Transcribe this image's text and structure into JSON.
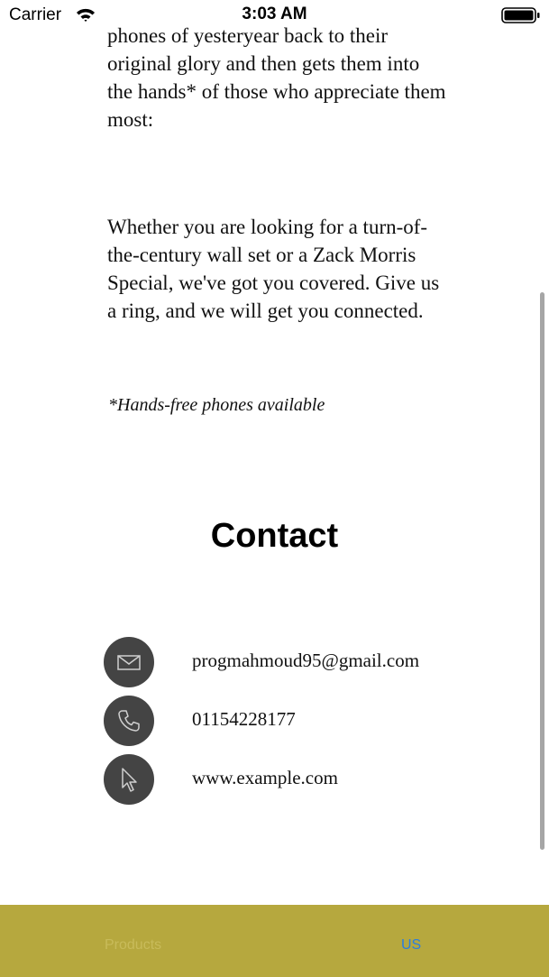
{
  "status_bar": {
    "carrier": "Carrier",
    "time": "3:03 AM"
  },
  "about": {
    "paragraph_1": "phones of  yesteryear back to their original glory and then gets them into the hands* of those who appreciate them most:",
    "paragraph_2": "Whether you are looking for a turn-of-the-century wall set or a Zack Morris Special, we've got you covered. Give us a ring, and we will get you connected.",
    "footnote": "*Hands-free phones available"
  },
  "contact": {
    "heading": "Contact",
    "email": "progmahmoud95@gmail.com",
    "phone": "01154228177",
    "website": "www.example.com"
  },
  "tabs": [
    {
      "label": "Products"
    },
    {
      "label": "US"
    }
  ],
  "colors": {
    "tab_bar_background": "#b6a83e",
    "tab_active": "#2a7de1",
    "tab_inactive": "#c8bb5a",
    "icon_circle": "#444444"
  },
  "icons": {
    "email": "envelope-icon",
    "phone": "phone-icon",
    "website": "cursor-icon"
  }
}
